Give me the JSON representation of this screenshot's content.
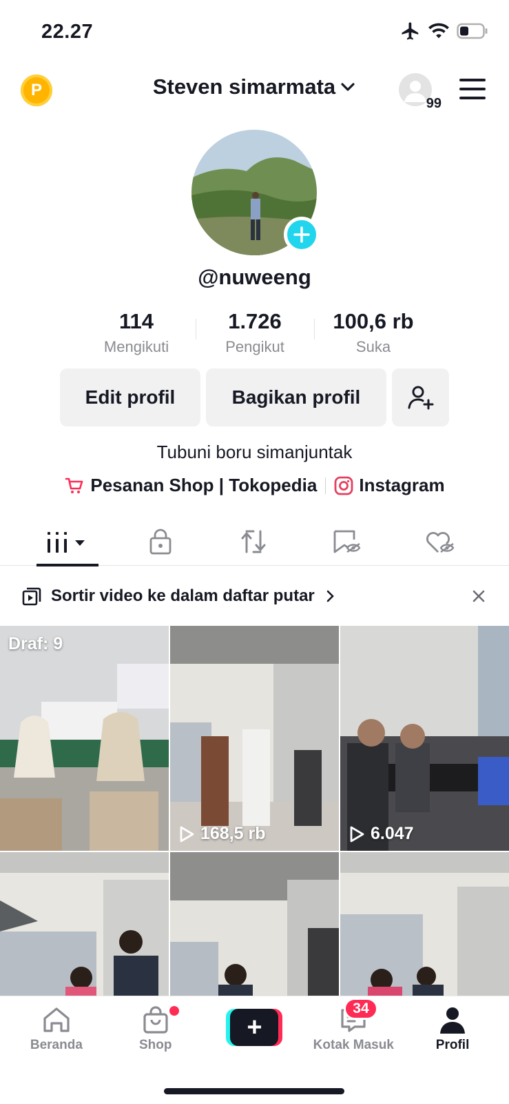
{
  "status_bar": {
    "time": "22.27"
  },
  "header": {
    "points_letter": "P",
    "profile_name": "Steven simarmata",
    "notif_count": "99"
  },
  "profile": {
    "username": "@nuweeng",
    "stats": [
      {
        "value": "114",
        "label": "Mengikuti"
      },
      {
        "value": "1.726",
        "label": "Pengikut"
      },
      {
        "value": "100,6 rb",
        "label": "Suka"
      }
    ],
    "edit_label": "Edit profil",
    "share_label": "Bagikan profil",
    "bio": "Tubuni boru simanjuntak",
    "links": {
      "shop": "Pesanan Shop | Tokopedia",
      "instagram": "Instagram"
    }
  },
  "tabs": [
    "videos-grid-icon",
    "lock-icon",
    "repost-icon",
    "saved-icon",
    "liked-icon"
  ],
  "banner": {
    "text": "Sortir video ke dalam daftar putar"
  },
  "grid": [
    {
      "label": "Draf: 9",
      "views": ""
    },
    {
      "label": "",
      "views": "168,5 rb"
    },
    {
      "label": "",
      "views": "6.047"
    },
    {
      "label": "",
      "views": ""
    },
    {
      "label": "",
      "views": ""
    },
    {
      "label": "",
      "views": ""
    }
  ],
  "nav": {
    "home": "Beranda",
    "shop": "Shop",
    "create": "+",
    "inbox": "Kotak Masuk",
    "inbox_badge": "34",
    "profile": "Profil"
  },
  "colors": {
    "accent_teal": "#20d5ec",
    "accent_red": "#fe2c55",
    "text": "#161823",
    "muted": "#8a8b91"
  }
}
